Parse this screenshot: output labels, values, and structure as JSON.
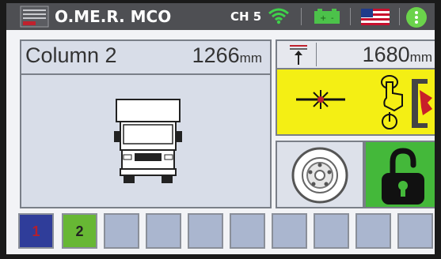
{
  "header": {
    "logo_icon": "omer-logo-icon",
    "brand": "O.ME.R. MCO",
    "channel": "CH 5",
    "wifi_icon": "wifi-icon",
    "battery_icon": "battery-icon",
    "flag_icon": "us-flag-icon",
    "menu_icon": "more-vertical-icon"
  },
  "column_panel": {
    "title": "Column 2",
    "height_value": "1266",
    "height_unit": "mm",
    "icon": "truck-front-icon"
  },
  "max_height_panel": {
    "icon": "max-height-icon",
    "value": "1680",
    "unit": "mm"
  },
  "laser_panel": {
    "laser_icon": "laser-level-icon",
    "press_icon": "press-to-raise-icon"
  },
  "wheel_panel": {
    "icon": "wheel-icon"
  },
  "lock_panel": {
    "icon": "unlock-padlock-icon"
  },
  "column_selector": {
    "items": [
      {
        "label": "1",
        "state": "selected"
      },
      {
        "label": "2",
        "state": "active"
      },
      {
        "label": "",
        "state": "empty"
      },
      {
        "label": "",
        "state": "empty"
      },
      {
        "label": "",
        "state": "empty"
      },
      {
        "label": "",
        "state": "empty"
      },
      {
        "label": "",
        "state": "empty"
      },
      {
        "label": "",
        "state": "empty"
      },
      {
        "label": "",
        "state": "empty"
      },
      {
        "label": "",
        "state": "empty"
      }
    ]
  },
  "colors": {
    "header_bg": "#4e4f53",
    "accent_green": "#44b83a",
    "warning_yellow": "#f4ef14",
    "selected_blue": "#2f3d9a"
  }
}
